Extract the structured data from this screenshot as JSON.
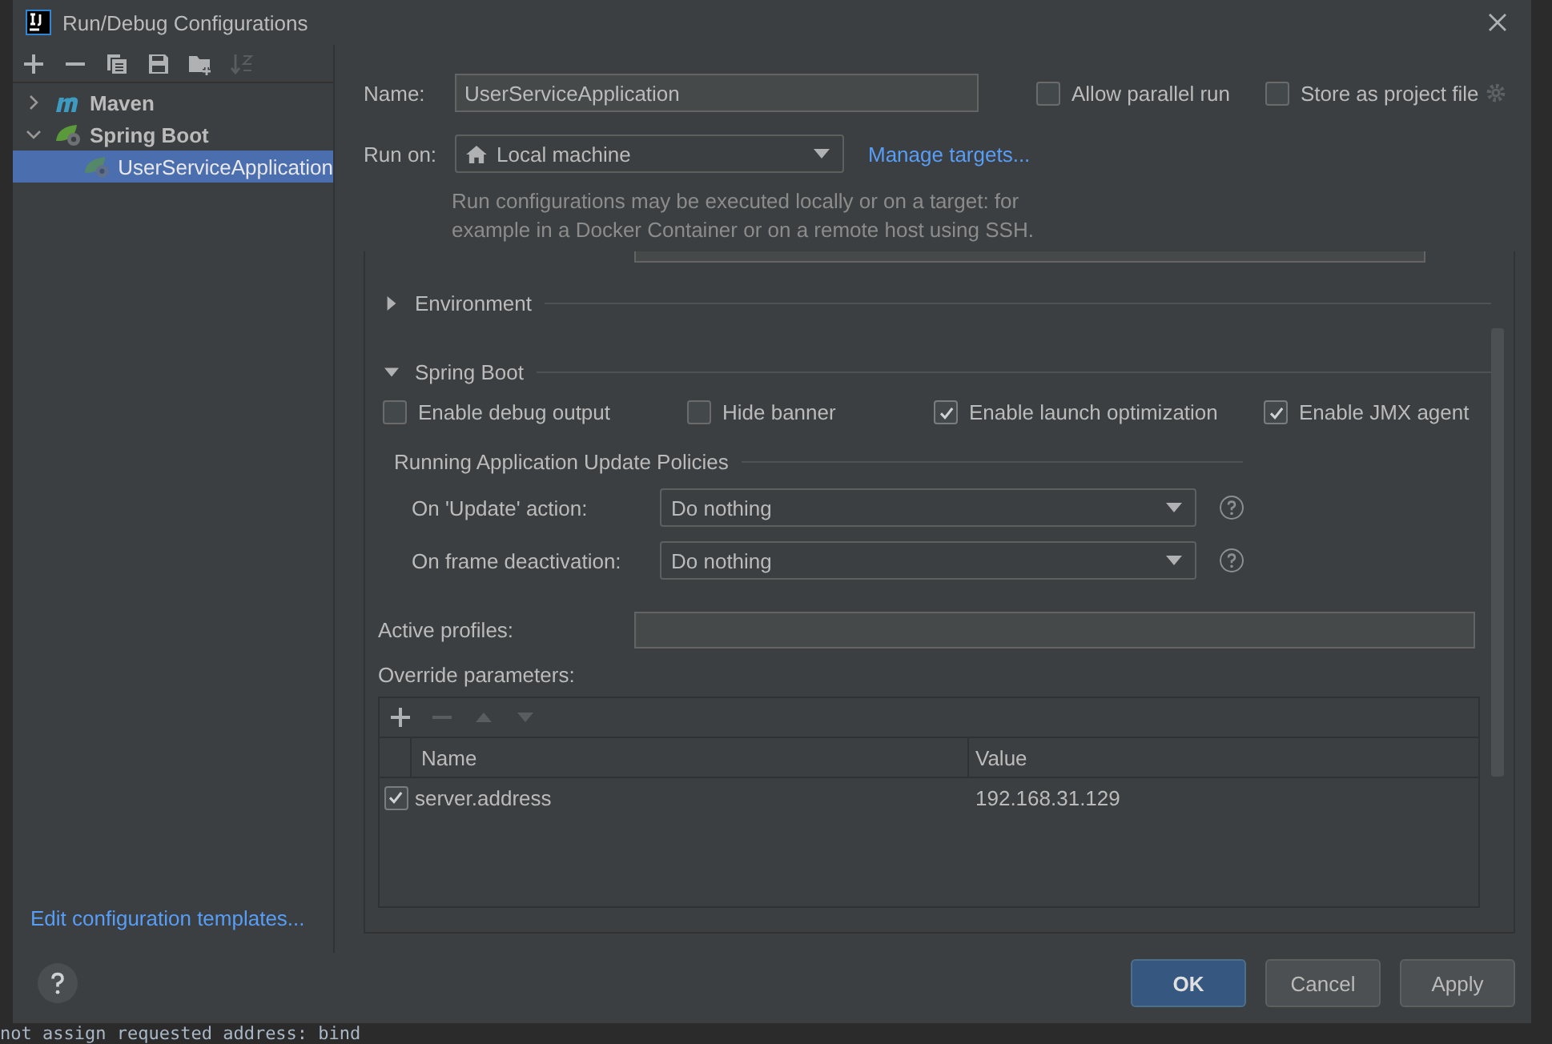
{
  "window": {
    "title": "Run/Debug Configurations"
  },
  "sidebar": {
    "toolbar": [
      {
        "kind": "add",
        "disabled": false
      },
      {
        "kind": "remove",
        "disabled": false
      },
      {
        "kind": "copy",
        "disabled": false
      },
      {
        "kind": "save",
        "disabled": false
      },
      {
        "kind": "folder",
        "disabled": false
      },
      {
        "kind": "sort",
        "disabled": true
      }
    ],
    "tree": [
      {
        "label": "Maven",
        "kind": "maven",
        "expanded": false,
        "selected": false
      },
      {
        "label": "Spring Boot",
        "kind": "spring",
        "expanded": true,
        "selected": false,
        "children": [
          {
            "label": "UserServiceApplication",
            "kind": "spring",
            "selected": true
          }
        ]
      }
    ],
    "footer_link": "Edit configuration templates..."
  },
  "name": {
    "label": "Name:",
    "value": "UserServiceApplication"
  },
  "options": [
    {
      "label": "Allow parallel run",
      "checked": false
    },
    {
      "label": "Store as project file",
      "checked": false
    }
  ],
  "run_on": {
    "label": "Run on:",
    "value": "Local machine",
    "link": "Manage targets...",
    "hint": "Run configurations may be executed locally or on a target: for example in a Docker Container or on a remote host using SSH."
  },
  "sections": [
    {
      "title": "Environment",
      "expanded": false
    },
    {
      "title": "Spring Boot",
      "expanded": true
    }
  ],
  "spring_checks": [
    {
      "label": "Enable debug output",
      "checked": false
    },
    {
      "label": "Hide banner",
      "checked": false
    },
    {
      "label": "Enable launch optimization",
      "checked": true
    },
    {
      "label": "Enable JMX agent",
      "checked": true
    }
  ],
  "policies": {
    "title": "Running Application Update Policies",
    "rows": [
      {
        "label": "On 'Update' action:",
        "value": "Do nothing"
      },
      {
        "label": "On frame deactivation:",
        "value": "Do nothing"
      }
    ]
  },
  "active_profiles": {
    "label": "Active profiles:"
  },
  "override": {
    "label": "Override parameters:",
    "toolbar": [
      {
        "kind": "add",
        "disabled": false
      },
      {
        "kind": "remove",
        "disabled": true
      },
      {
        "kind": "up",
        "disabled": true
      },
      {
        "kind": "down",
        "disabled": true
      }
    ],
    "columns": [
      "Name",
      "Value"
    ],
    "rows": [
      {
        "checked": true,
        "name": "server.address",
        "value": "192.168.31.129"
      }
    ]
  },
  "buttons": [
    {
      "label": "OK",
      "kind": "primary"
    },
    {
      "label": "Cancel",
      "kind": "normal"
    },
    {
      "label": "Apply",
      "kind": "normal"
    }
  ],
  "console_line": "not assign requested address: bind"
}
